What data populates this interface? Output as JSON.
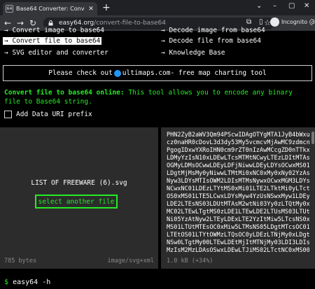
{
  "browser": {
    "tab_title": "Base64 Converter: Convert file to",
    "favicon_text": "64",
    "url_host": "easy64.org",
    "url_path": "/convert-file-to-base64",
    "profile_label": "Incognito (3)",
    "icons": [
      "back-arrow",
      "forward-arrow",
      "reload",
      "lock",
      "star",
      "extensions",
      "sidebar",
      "incognito",
      "menu"
    ]
  },
  "nav": {
    "items": [
      {
        "label": "→ Convert image to base64",
        "active": false
      },
      {
        "label": "→ Decode image from base64",
        "active": false
      },
      {
        "label": "→ Convert file to base64",
        "active": true
      },
      {
        "label": "→ Decode file from base64",
        "active": false
      },
      {
        "label": "→ SVG editor and converter",
        "active": false
      },
      {
        "label": "→ Knowledge Base",
        "active": false
      }
    ]
  },
  "banner": {
    "prefix": "Please check out ",
    "link": "ultimaps.com",
    "suffix": " - free map charting tool"
  },
  "intro": {
    "heading": "Convert file to base64 online:",
    "text": " This tool allows you to encode any binary file to Base64 string."
  },
  "options": {
    "data_uri_label": "Add Data URI prefix",
    "data_uri_checked": false
  },
  "input_panel": {
    "filename": "LIST OF FREEWARE (6).svg",
    "select_label": "select another file",
    "size": "785 bytes",
    "mime": "image/svg+xml"
  },
  "output_panel": {
    "lines": [
      "PHN2ZyB2aWV3Qm94PScwIDAgOTYgMTA1JyB4bWxu",
      "cz0naHR0cDovL3d3dy53My5vcmcvMjAwMC9zdmcn",
      "PgogIDxwYXRoIHN0cm9rZT0nIzAwMCcgZD0nTTkx",
      "LDMyYzIsN10xLDEwLTcsMTMtNCwyLTEzLDItMTAs",
      "OGMyLDMsOCwwLDEyLDFjNiwwLDEyLDYsOCwxMS01",
      "LDgtMjMsMy0yNiwwLTMtMi0xNC0xMy0xNy02YzAs",
      "Nyw3LDYsMTIsOWM2LDIsMTMsNywxOCwxMGM3LDYs",
      "NCwxNC01LDEzLTYtMS0xMi01LTE2LTktMi0yLTct",
      "OS0xMS01LTE5LCwxLDYsMyw4YzUsNSwxMyw1LDEy",
      "LDE2LTEsNS03LDUtMTAsM2wtNi03Yy0zLTQtMy0x",
      "MC02LTEwLTgtMS0zLDE1LTEwLDE2LTUsMS03LTUt",
      "Ni05YzAtNyw2LTEyLDExLTE2YzItMiw5LTcsNS0x",
      "MS01LTUtMTEsOC0xMiw5LTMsNS05LDgtMTcsOC01",
      "LTEtOS01LTYtOWMzLTQsOC0yLDEzLTNjMy0xLDgt",
      "NSw0LTgtMy00LTEwLDEtMjItMTNjMy03LDI3LDIs",
      "MzIsM2MzLDAsOSwxLDEwLTJiMS02LTctNC0xMS00"
    ],
    "size": "1.0 kB (+34%)"
  },
  "terminal": {
    "prompt": "$",
    "command": "easy64 -h"
  }
}
